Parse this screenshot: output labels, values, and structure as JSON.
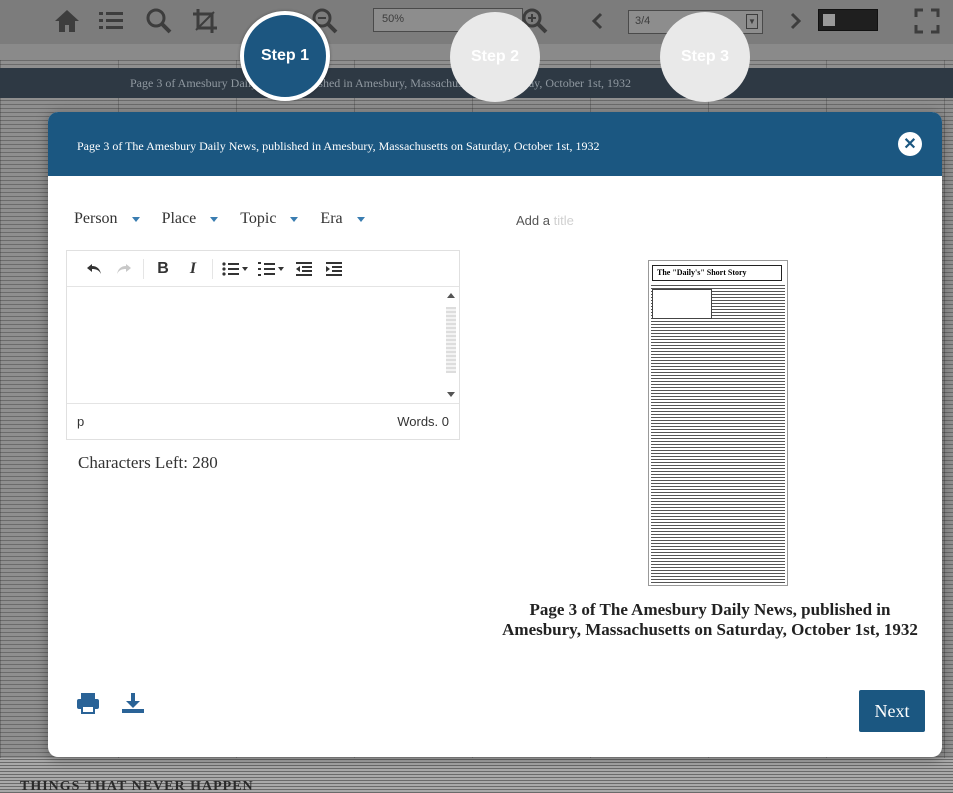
{
  "viewer": {
    "zoom_value": "50%",
    "page_value": "3/4",
    "page_banner": "Page 3 of Amesbury Daily News, published in Amesbury, Massachusetts on Saturday, October 1st, 1932",
    "bottom_headline": "THINGS THAT NEVER HAPPEN",
    "toolbar_icons": [
      "home-icon",
      "list-icon",
      "search-icon",
      "crop-icon",
      "zoom-out-icon",
      "zoom-in-icon",
      "chevron-left-icon",
      "chevron-right-icon",
      "fullscreen-icon"
    ]
  },
  "steps": [
    {
      "label": "Step 1",
      "active": true
    },
    {
      "label": "Step 2",
      "active": false
    },
    {
      "label": "Step 3",
      "active": false
    }
  ],
  "modal": {
    "title": "Page 3 of The Amesbury Daily News, published in Amesbury, Massachusetts on Saturday, October 1st, 1932",
    "close_icon": "close-icon",
    "tags": [
      {
        "label": "Person"
      },
      {
        "label": "Place"
      },
      {
        "label": "Topic"
      },
      {
        "label": "Era"
      }
    ],
    "title_input": {
      "prefix": "Add a",
      "placeholder": "title"
    },
    "editor": {
      "path": "p",
      "word_count": "Words. 0",
      "tools": [
        "undo-icon",
        "redo-icon",
        "bold-icon",
        "italic-icon",
        "bullet-list-icon",
        "numbered-list-icon",
        "outdent-icon",
        "indent-icon"
      ]
    },
    "characters_left": "Characters Left: 280",
    "preview": {
      "headline": "The \"Daily's\" Short Story",
      "caption": "Page 3 of The Amesbury Daily News, published in Amesbury, Massachusetts on Saturday, October 1st, 1932"
    },
    "next_label": "Next",
    "colors": {
      "accent": "#1b5781",
      "dropdown_caret": "#3a7db1"
    }
  }
}
